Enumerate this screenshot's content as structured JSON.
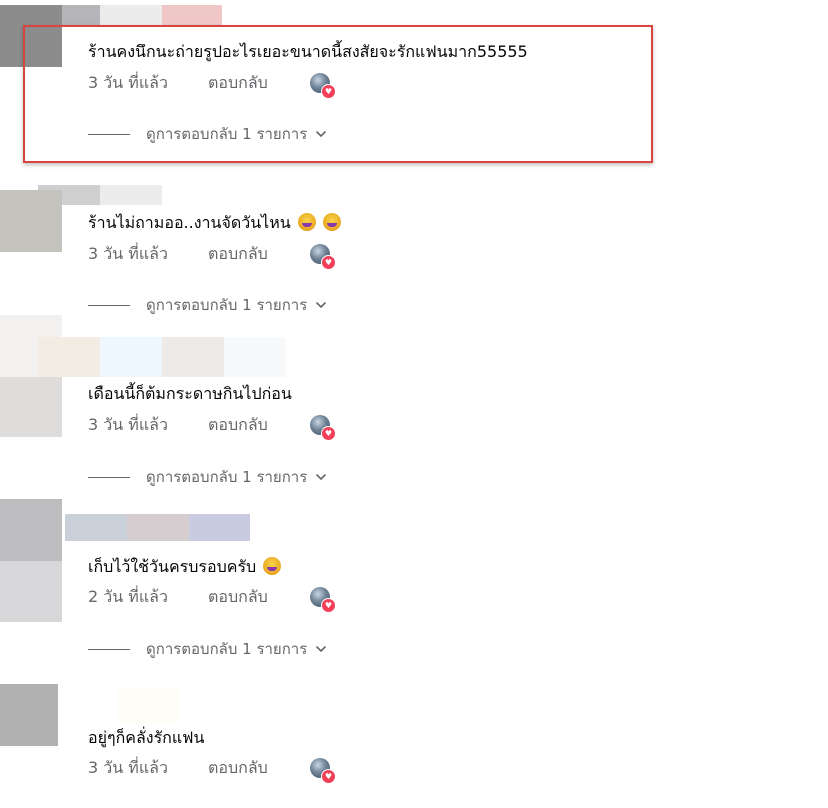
{
  "comments": [
    {
      "text": "ร้านคงนึกนะถ่ายรูปอะไรเยอะขนาดนี้สงสัยจะรักแฟนมาก55555",
      "emoji_count": 0,
      "time": "3 วัน ที่แล้ว",
      "reply": "ตอบกลับ",
      "reaction_badge": "heart-icon",
      "view_replies": "ดูการตอบกลับ 1 รายการ"
    },
    {
      "text": "ร้านไม่ถามออ..งานจัดวันไหน",
      "emoji_count": 2,
      "time": "3 วัน ที่แล้ว",
      "reply": "ตอบกลับ",
      "reaction_badge": "heart-icon",
      "view_replies": "ดูการตอบกลับ 1 รายการ"
    },
    {
      "text": "เดือนนี้ก็ต้มกระดาษกินไปก่อน",
      "emoji_count": 0,
      "time": "3 วัน ที่แล้ว",
      "reply": "ตอบกลับ",
      "reaction_badge": "heart-icon",
      "view_replies": "ดูการตอบกลับ 1 รายการ"
    },
    {
      "text": "เก็บไว้ใช้วันครบรอบครับ",
      "emoji_count": 1,
      "time": "2 วัน ที่แล้ว",
      "reply": "ตอบกลับ",
      "reaction_badge": "heart-icon",
      "view_replies": "ดูการตอบกลับ 1 รายการ"
    },
    {
      "text": "อยู่ๆก็คลั่งรักแฟน",
      "emoji_count": 0,
      "time": "3 วัน ที่แล้ว",
      "reply": "ตอบกลับ",
      "reaction_badge": "heart-icon"
    }
  ],
  "colors": {
    "text_primary": "#050505",
    "text_secondary": "#65676b",
    "heart": "#f33e58",
    "highlight_border": "#d9443f"
  }
}
